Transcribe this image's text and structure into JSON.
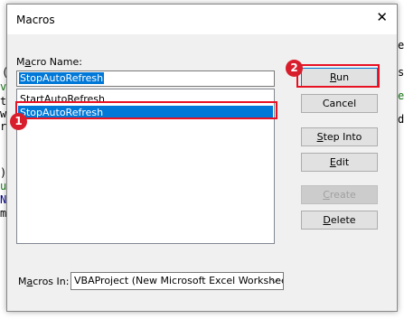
{
  "dialog": {
    "title": "Macros",
    "close_glyph": "✕"
  },
  "macro_name": {
    "label_prefix": "M",
    "label_underline": "a",
    "label_rest": "cro Name:",
    "value": "StopAutoRefresh"
  },
  "macro_list": {
    "items": [
      {
        "label": "StartAutoRefresh",
        "selected": false
      },
      {
        "label": "StopAutoRefresh",
        "selected": true
      }
    ]
  },
  "annotations": {
    "badge_1": "1",
    "badge_2": "2",
    "color": "#e81123"
  },
  "buttons": [
    {
      "u": "R",
      "rest": "un",
      "pre": "",
      "enabled": true,
      "default": true
    },
    {
      "u": "",
      "rest": "Cancel",
      "pre": "",
      "enabled": true,
      "default": false
    },
    {
      "u": "S",
      "rest": "tep Into",
      "pre": "",
      "enabled": true,
      "default": false
    },
    {
      "u": "E",
      "rest": "dit",
      "pre": "",
      "enabled": true,
      "default": false
    },
    {
      "u": "C",
      "rest": "reate",
      "pre": "",
      "enabled": false,
      "default": false
    },
    {
      "u": "D",
      "rest": "elete",
      "pre": "",
      "enabled": true,
      "default": false
    }
  ],
  "macros_in": {
    "label_prefix": "M",
    "label_underline": "a",
    "label_rest": "cros In:",
    "value": "VBAProject (New Microsoft Excel Worksheet",
    "chevron": "⌵"
  },
  "background_fragments": [
    "(",
    "v",
    "t",
    "w",
    "r",
    ")",
    "u",
    "N",
    "m",
    "s",
    "e",
    "d",
    "e"
  ]
}
